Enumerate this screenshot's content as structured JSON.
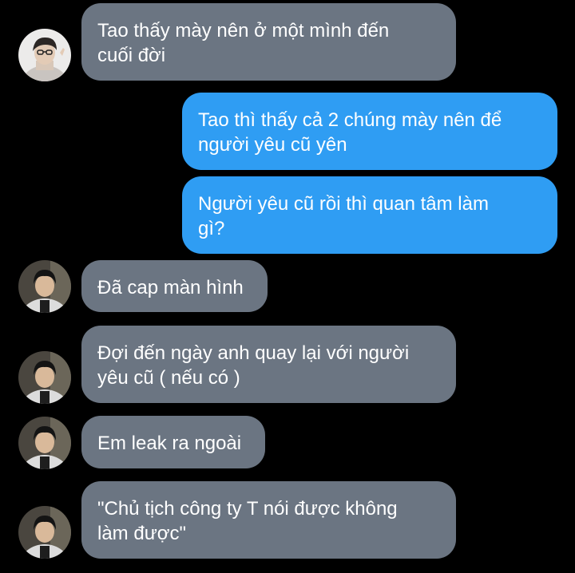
{
  "messages": [
    {
      "sender": "friend-1",
      "text": "Tao thấy mày nên ở một mình đến\ncuối đời"
    },
    {
      "sender": "me",
      "text": "Tao thì thấy cả 2 chúng mày nên để\nngười yêu cũ yên"
    },
    {
      "sender": "me",
      "text": "Người yêu cũ rồi thì quan tâm làm\ngì?"
    },
    {
      "sender": "friend-2",
      "text": "Đã cap màn hình"
    },
    {
      "sender": "friend-2",
      "text": "Đợi đến ngày anh quay lại với người\nyêu cũ ( nếu có )"
    },
    {
      "sender": "friend-2",
      "text": "Em leak ra ngoài"
    },
    {
      "sender": "friend-2",
      "text": "\"Chủ tịch công ty T nói được không\nlàm được\""
    }
  ],
  "colors": {
    "background": "#000000",
    "incoming_bubble": "#6b7582",
    "outgoing_bubble": "#2f9df3",
    "text": "#ffffff"
  }
}
